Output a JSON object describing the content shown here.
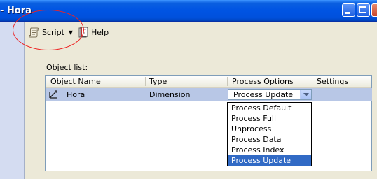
{
  "window": {
    "title": "- Hora"
  },
  "toolbar": {
    "script_label": "Script",
    "help_label": "Help"
  },
  "object_list": {
    "label": "Object list:",
    "columns": [
      "Object Name",
      "Type",
      "Process Options",
      "Settings"
    ],
    "rows": [
      {
        "name": "Hora",
        "type": "Dimension",
        "process_option": "Process Update",
        "settings": ""
      }
    ]
  },
  "process_dropdown": {
    "options": [
      "Process Default",
      "Process Full",
      "Unprocess",
      "Process Data",
      "Process Index",
      "Process Update"
    ],
    "selected": "Process Update"
  },
  "colors": {
    "title_bar": "#0054e3",
    "selection": "#316ac5",
    "row_highlight": "#b8c7e6",
    "annotation": "#e22222"
  }
}
